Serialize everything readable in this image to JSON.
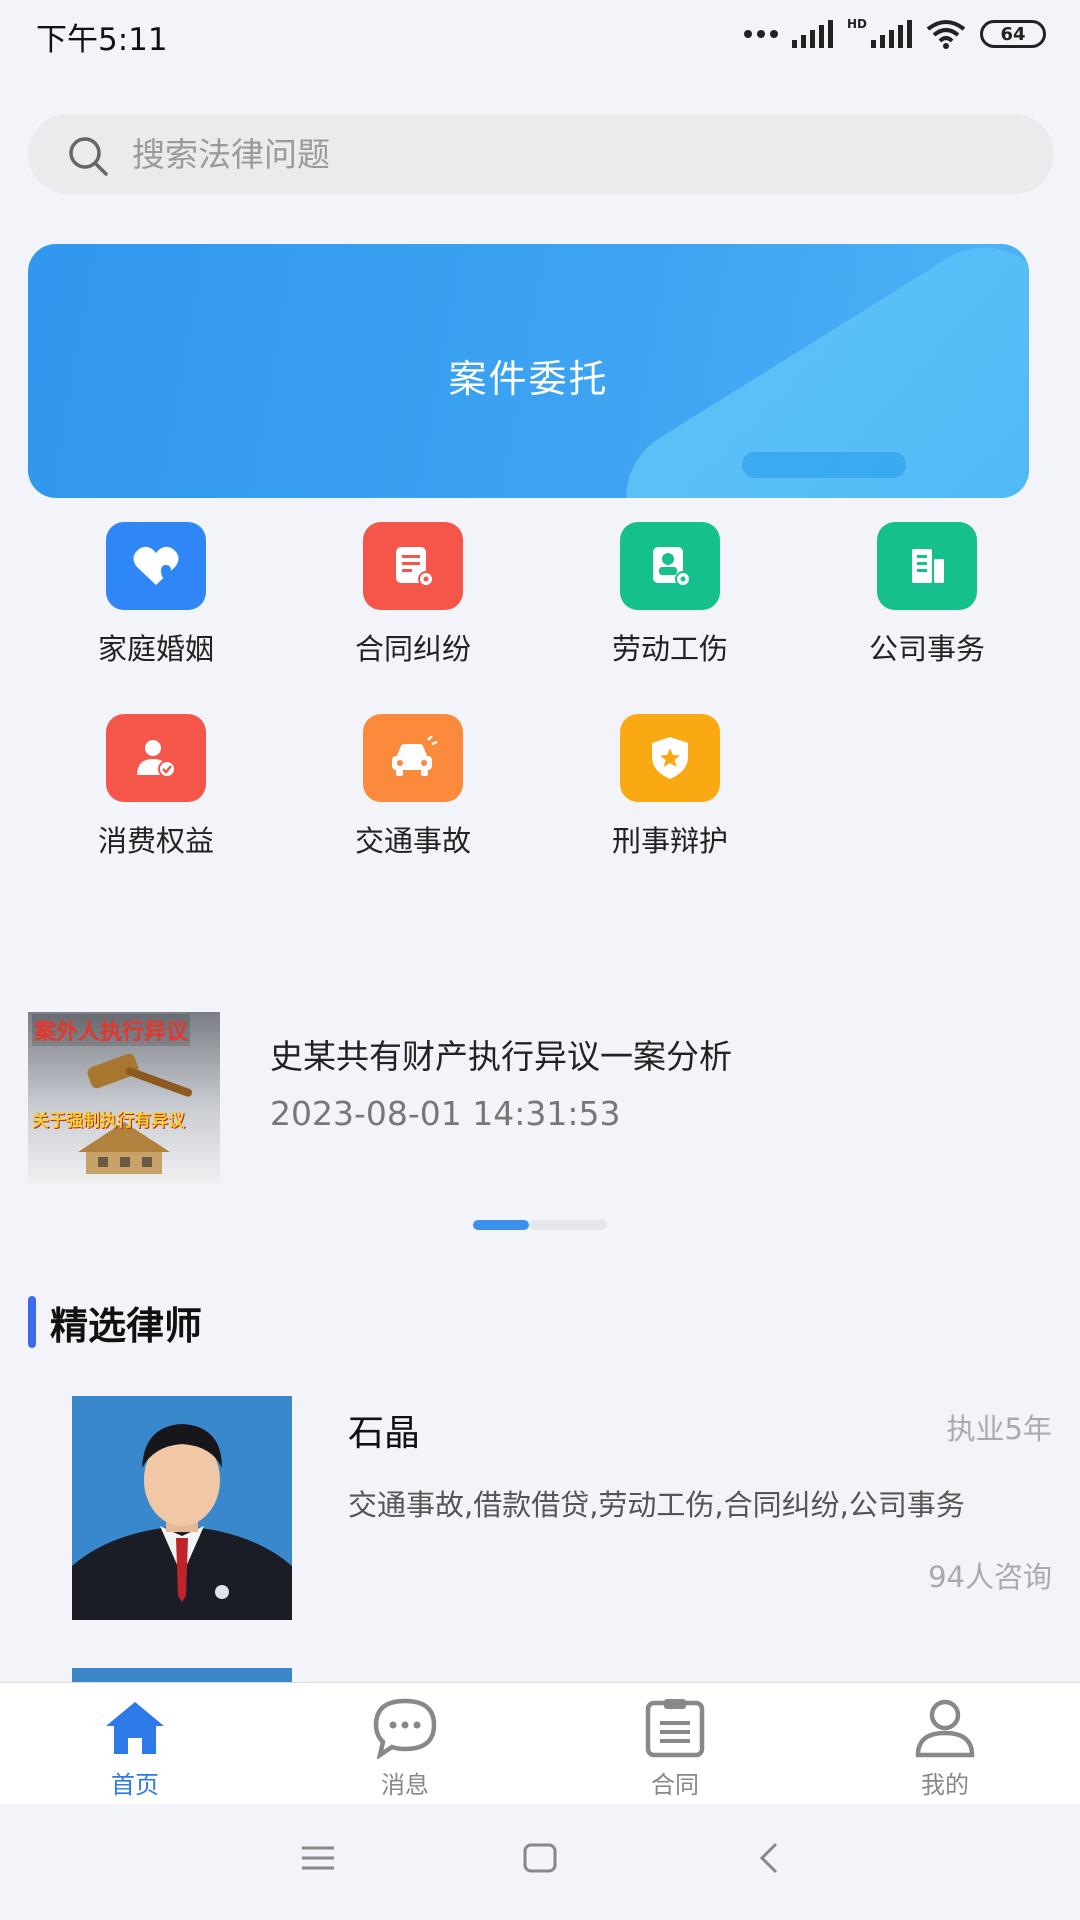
{
  "status_bar": {
    "time": "下午5:11",
    "hd_label": "HD",
    "battery": "64"
  },
  "search": {
    "placeholder": "搜索法律问题"
  },
  "banner": {
    "title": "案件委托"
  },
  "categories": [
    {
      "label": "家庭婚姻",
      "color": "#2f86f6",
      "icon": "heart-icon"
    },
    {
      "label": "合同纠纷",
      "color": "#f4564a",
      "icon": "document-icon"
    },
    {
      "label": "劳动工伤",
      "color": "#16c08c",
      "icon": "worker-badge-icon"
    },
    {
      "label": "公司事务",
      "color": "#16c08c",
      "icon": "building-icon"
    },
    {
      "label": "消费权益",
      "color": "#f4564a",
      "icon": "consumer-icon"
    },
    {
      "label": "交通事故",
      "color": "#fb8a3c",
      "icon": "car-icon"
    },
    {
      "label": "刑事辩护",
      "color": "#fba913",
      "icon": "shield-star-icon"
    }
  ],
  "news": {
    "thumb_text_top": "案外人执行异议",
    "thumb_text_bottom": "关于强制执行有异议",
    "title": "史某共有财产执行异议一案分析",
    "date": "2023-08-01 14:31:53"
  },
  "section": {
    "title": "精选律师"
  },
  "lawyers": [
    {
      "name": "石晶",
      "years": "执业5年",
      "tags": "交通事故,借款借贷,劳动工伤,合同纠纷,公司事务",
      "consults": "94人咨询"
    }
  ],
  "tabs": [
    {
      "label": "首页",
      "icon": "home-icon",
      "active": true
    },
    {
      "label": "消息",
      "icon": "chat-bubble-icon",
      "active": false
    },
    {
      "label": "合同",
      "icon": "clipboard-icon",
      "active": false
    },
    {
      "label": "我的",
      "icon": "person-icon",
      "active": false
    }
  ],
  "colors": {
    "accent": "#2d7ae8",
    "banner": "#3ea4f2",
    "section_bar": "#3b6cf0"
  }
}
